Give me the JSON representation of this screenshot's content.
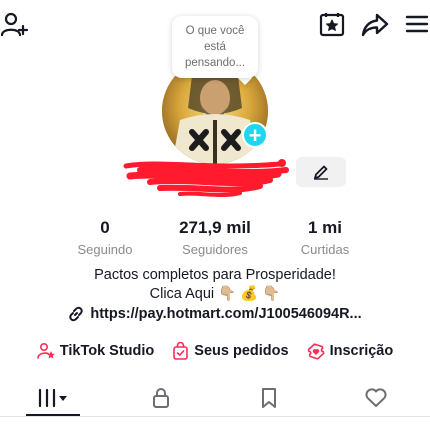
{
  "note": {
    "text": "O que você está pensando..."
  },
  "stats": {
    "following": {
      "value": "0",
      "label": "Seguindo"
    },
    "followers": {
      "value": "271,9 mil",
      "label": "Seguidores"
    },
    "likes": {
      "value": "1 mi",
      "label": "Curtidas"
    }
  },
  "bio": {
    "line1": "Pactos completos para Prosperidade!",
    "line2": "Clica Aqui 👇🏼 💰 👇🏼",
    "link": "https://pay.hotmart.com/J100546094R..."
  },
  "shortcuts": [
    {
      "label": "TikTok Studio",
      "icon": "person-star-icon"
    },
    {
      "label": "Seus pedidos",
      "icon": "bag-check-icon"
    },
    {
      "label": "Inscrição",
      "icon": "heart-ticket-icon"
    }
  ],
  "tabs": [
    {
      "name": "videos-grid-icon"
    },
    {
      "name": "lock-icon"
    },
    {
      "name": "bookmark-icon"
    },
    {
      "name": "heart-icon"
    }
  ],
  "colors": {
    "accent": "#fe2c55",
    "story_add": "#20d5ec",
    "redaction": "#ff1a2e"
  }
}
